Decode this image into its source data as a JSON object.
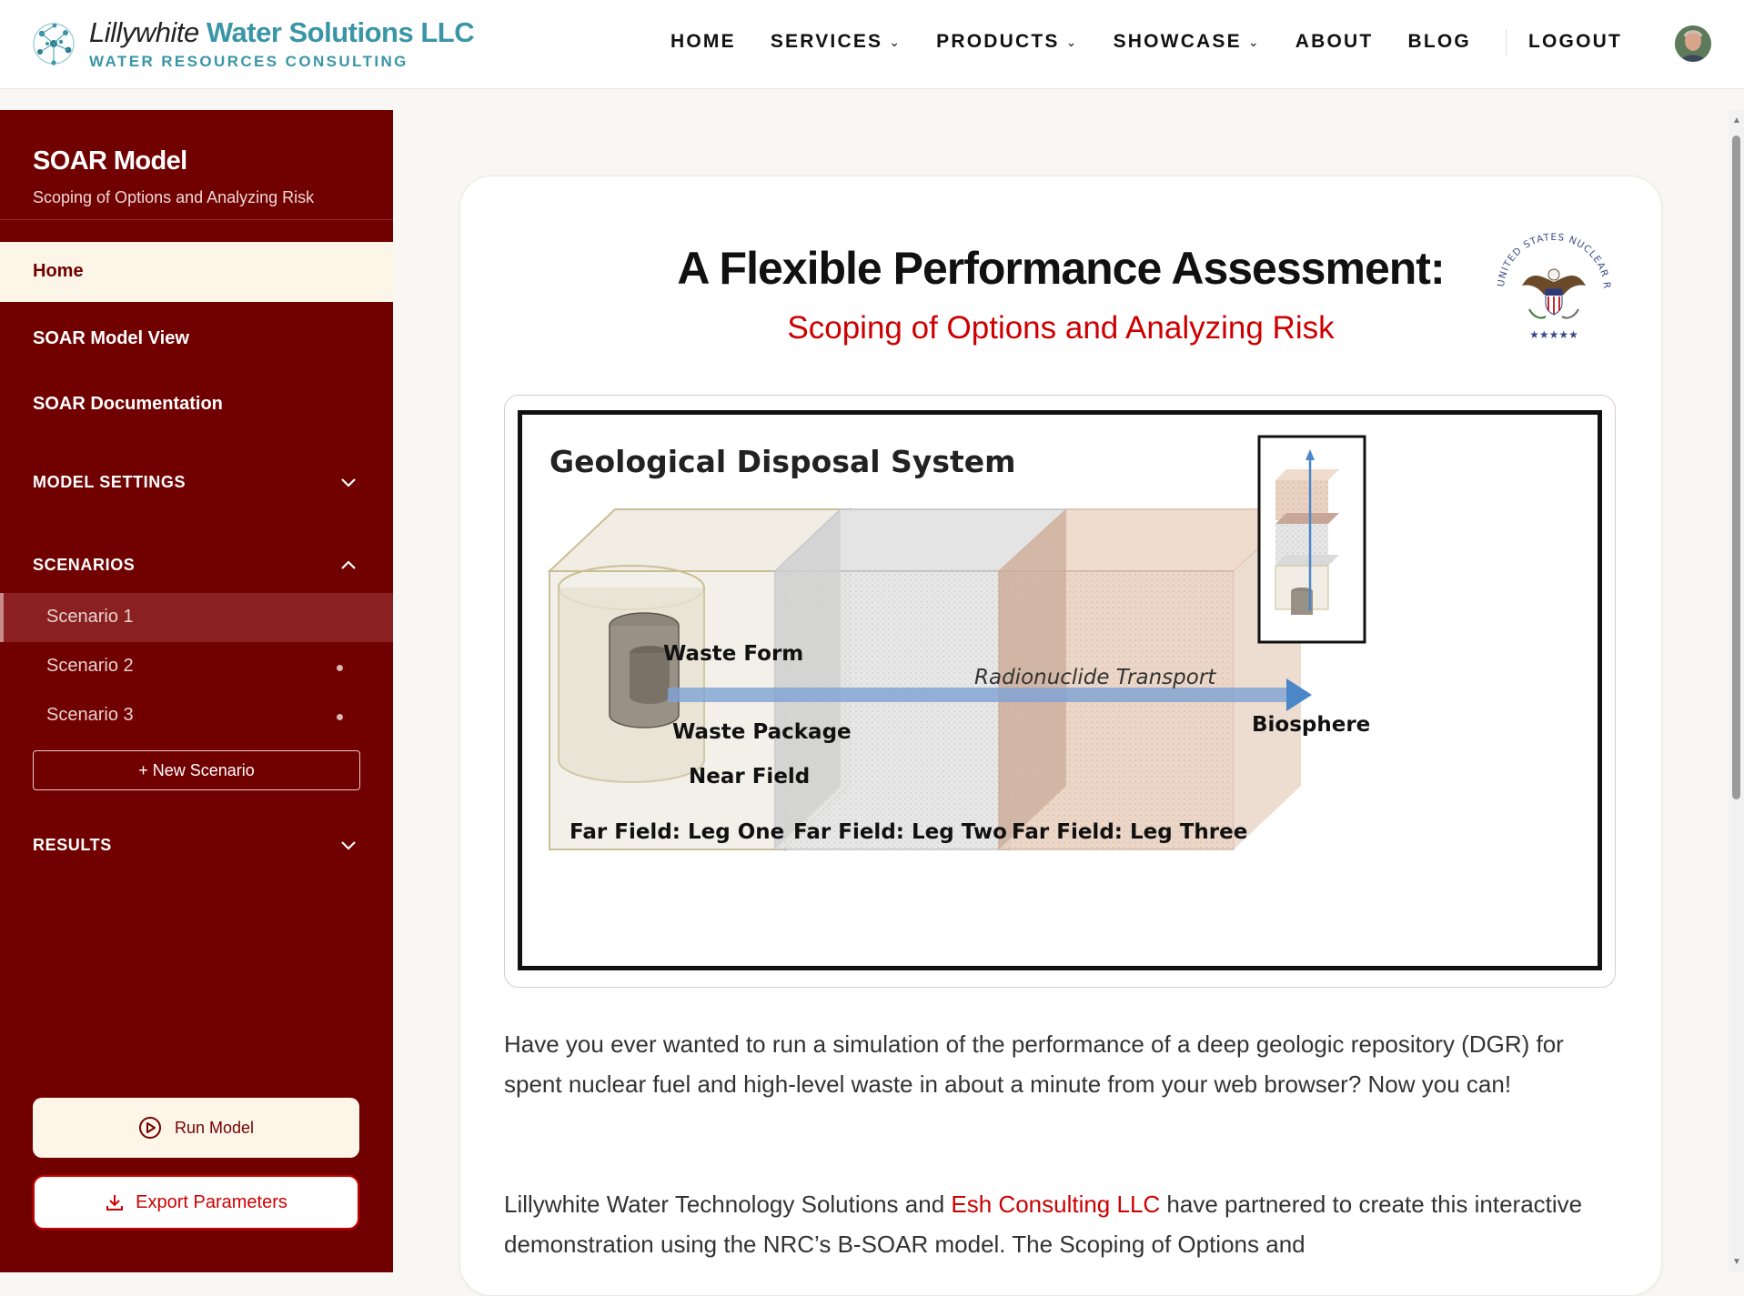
{
  "brand": {
    "name_part1": "Lillywhite",
    "name_part2": "Water Solutions LLC",
    "tagline": "WATER RESOURCES CONSULTING"
  },
  "nav": {
    "items": [
      {
        "label": "HOME",
        "has_dropdown": false
      },
      {
        "label": "SERVICES",
        "has_dropdown": true
      },
      {
        "label": "PRODUCTS",
        "has_dropdown": true
      },
      {
        "label": "SHOWCASE",
        "has_dropdown": true
      },
      {
        "label": "ABOUT",
        "has_dropdown": false
      },
      {
        "label": "BLOG",
        "has_dropdown": false
      }
    ],
    "logout": "LOGOUT"
  },
  "sidebar": {
    "title": "SOAR Model",
    "subtitle": "Scoping of Options and Analyzing Risk",
    "links": [
      {
        "label": "Home",
        "active": true
      },
      {
        "label": "SOAR Model View",
        "active": false
      },
      {
        "label": "SOAR Documentation",
        "active": false
      }
    ],
    "sections": {
      "model_settings": {
        "label": "MODEL SETTINGS",
        "expanded": false
      },
      "scenarios": {
        "label": "SCENARIOS",
        "expanded": true
      },
      "results": {
        "label": "RESULTS",
        "expanded": false
      }
    },
    "scenarios": [
      {
        "label": "Scenario 1",
        "selected": true
      },
      {
        "label": "Scenario 2",
        "selected": false
      },
      {
        "label": "Scenario 3",
        "selected": false
      }
    ],
    "new_scenario": "+ New Scenario",
    "run_model": "Run Model",
    "export_parameters": "Export Parameters"
  },
  "main": {
    "title": "A Flexible Performance Assessment:",
    "subtitle": "Scoping of Options and Analyzing Risk",
    "seal_text": "UNITED STATES NUCLEAR REGULATORY COMMISSION",
    "figure": {
      "title": "Geological Disposal System",
      "waste_form": "Waste Form",
      "waste_package": "Waste Package",
      "near_field": "Near Field",
      "transport": "Radionuclide Transport",
      "biosphere": "Biosphere",
      "leg_one": "Far Field: Leg One",
      "leg_two": "Far Field: Leg Two",
      "leg_three": "Far Field: Leg Three"
    },
    "para1": "Have you ever wanted to run a simulation of the performance of a deep geologic repository (DGR) for spent nuclear fuel and high-level waste in about a minute from your web browser? Now you can!",
    "para2_before": "Lillywhite Water Technology Solutions and ",
    "para2_link": "Esh Consulting LLC",
    "para2_after": " have partnered to create this interactive demonstration using the NRC’s B-SOAR model. The Scoping of Options and"
  },
  "colors": {
    "sidebar_bg": "#710000",
    "accent_red": "#cc0000",
    "brand_teal": "#3a95a6",
    "cream": "#fdf6e8"
  }
}
